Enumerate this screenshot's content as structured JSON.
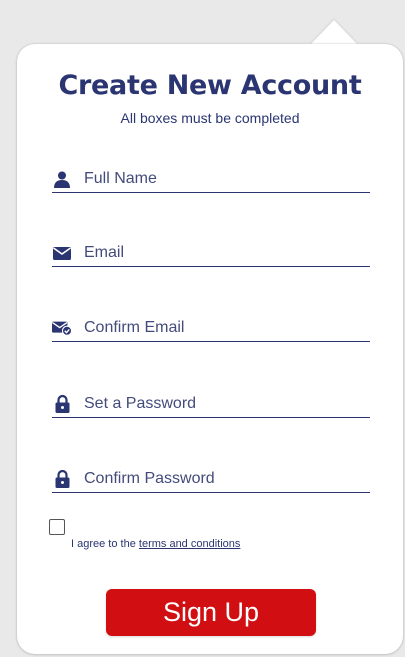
{
  "header": {
    "title": "Create New Account",
    "subtitle": "All boxes must be completed"
  },
  "fields": [
    {
      "name": "full-name",
      "icon": "user-icon",
      "placeholder": "Full Name",
      "value": ""
    },
    {
      "name": "email",
      "icon": "envelope-icon",
      "placeholder": "Email",
      "value": ""
    },
    {
      "name": "confirm-email",
      "icon": "envelope-check-icon",
      "placeholder": "Confirm Email",
      "value": ""
    },
    {
      "name": "password",
      "icon": "lock-icon",
      "placeholder": "Set a Password",
      "value": ""
    },
    {
      "name": "confirm-password",
      "icon": "lock-icon",
      "placeholder": "Confirm Password",
      "value": ""
    }
  ],
  "agreement": {
    "prefix": "I agree to the ",
    "link_text": "terms and conditions",
    "checked": false
  },
  "signup": {
    "label": "Sign Up"
  },
  "colors": {
    "primary": "#2a3572",
    "accent": "#d10f12",
    "background": "#e9e9ea",
    "card": "#ffffff"
  }
}
